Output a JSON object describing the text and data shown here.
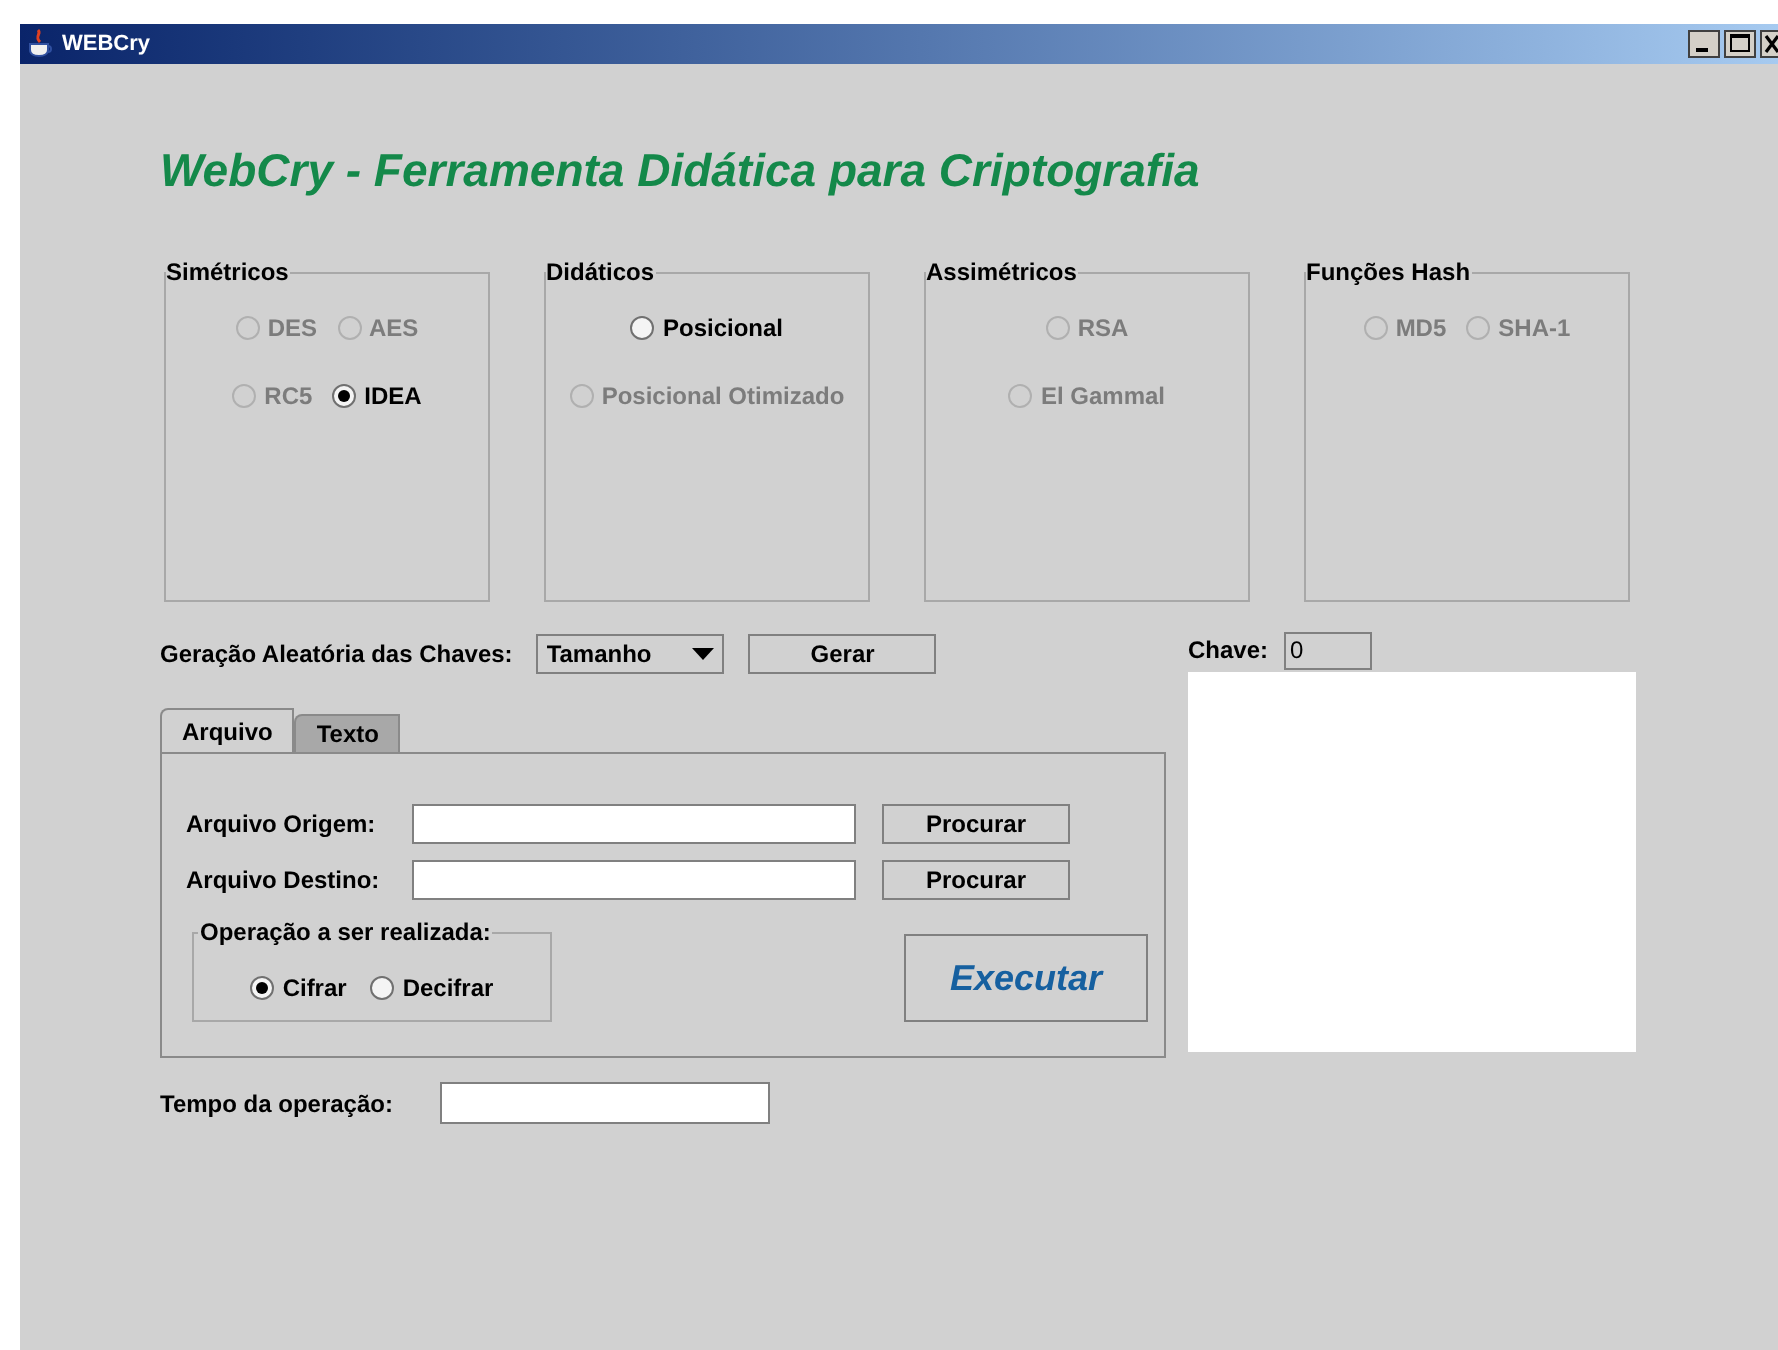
{
  "window": {
    "title": "WEBCry"
  },
  "heading": "WebCry -  Ferramenta Didática para Criptografia",
  "groups": [
    {
      "title": "Simétricos",
      "rows": [
        [
          {
            "label": "DES",
            "selected": false,
            "disabled": true
          },
          {
            "label": "AES",
            "selected": false,
            "disabled": true
          }
        ],
        [
          {
            "label": "RC5",
            "selected": false,
            "disabled": true
          },
          {
            "label": "IDEA",
            "selected": true,
            "disabled": false
          }
        ]
      ]
    },
    {
      "title": "Didáticos",
      "rows": [
        [
          {
            "label": "Posicional",
            "selected": false,
            "disabled": false
          }
        ],
        [
          {
            "label": "Posicional Otimizado",
            "selected": false,
            "disabled": true
          }
        ]
      ]
    },
    {
      "title": "Assimétricos",
      "rows": [
        [
          {
            "label": "RSA",
            "selected": false,
            "disabled": true
          }
        ],
        [
          {
            "label": "El Gammal",
            "selected": false,
            "disabled": true
          }
        ]
      ]
    },
    {
      "title": "Funções Hash",
      "rows": [
        [
          {
            "label": "MD5",
            "selected": false,
            "disabled": true
          },
          {
            "label": "SHA-1",
            "selected": false,
            "disabled": true
          }
        ]
      ]
    }
  ],
  "keygen": {
    "label": "Geração Aleatória das Chaves:",
    "size_select": "Tamanho",
    "button": "Gerar"
  },
  "key": {
    "label": "Chave:",
    "value": "0"
  },
  "tabs": [
    {
      "label": "Arquivo",
      "selected": true
    },
    {
      "label": "Texto",
      "selected": false
    }
  ],
  "files": [
    {
      "label": "Arquivo Origem:",
      "button": "Procurar"
    },
    {
      "label": "Arquivo Destino:",
      "button": "Procurar"
    }
  ],
  "operation": {
    "title": "Operação a ser realizada:",
    "options": [
      {
        "label": "Cifrar",
        "selected": true
      },
      {
        "label": "Decifrar",
        "selected": false
      }
    ]
  },
  "execute_button": "Executar",
  "time": {
    "label": "Tempo da operação:"
  }
}
